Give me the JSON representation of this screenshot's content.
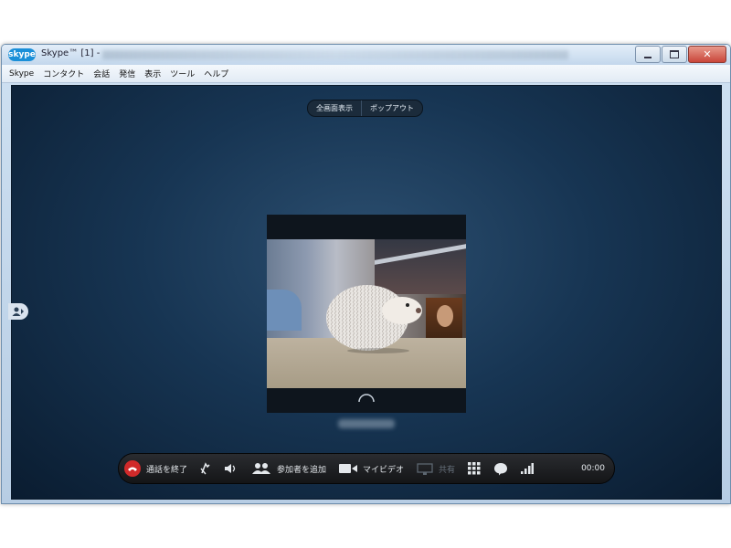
{
  "window": {
    "app_logo": "skype",
    "title": "Skype™ [1] -"
  },
  "menu": [
    "Skype",
    "コンタクト",
    "会話",
    "発信",
    "表示",
    "ツール",
    "ヘルプ"
  ],
  "view_toggle": {
    "fullscreen_label": "全画面表示",
    "popout_label": "ポップアウト"
  },
  "call_bar": {
    "end_call_label": "通話を終了",
    "add_participant_label": "参加者を追加",
    "my_video_label": "マイビデオ",
    "share_label": "共有",
    "timer": "00:00"
  },
  "colors": {
    "stage_top": "#2c4f70",
    "stage_bottom": "#0a1c30",
    "end_call": "#d12a2a",
    "title_bar": "#cfe1f2"
  },
  "icons": [
    "skype-logo",
    "minimize-icon",
    "maximize-icon",
    "close-icon",
    "contacts-toggle-icon",
    "end-call-icon",
    "hold-icon",
    "speaker-icon",
    "add-people-icon",
    "video-camera-icon",
    "screen-share-icon",
    "dialpad-icon",
    "chat-icon",
    "signal-strength-icon",
    "loading-spinner-icon"
  ]
}
